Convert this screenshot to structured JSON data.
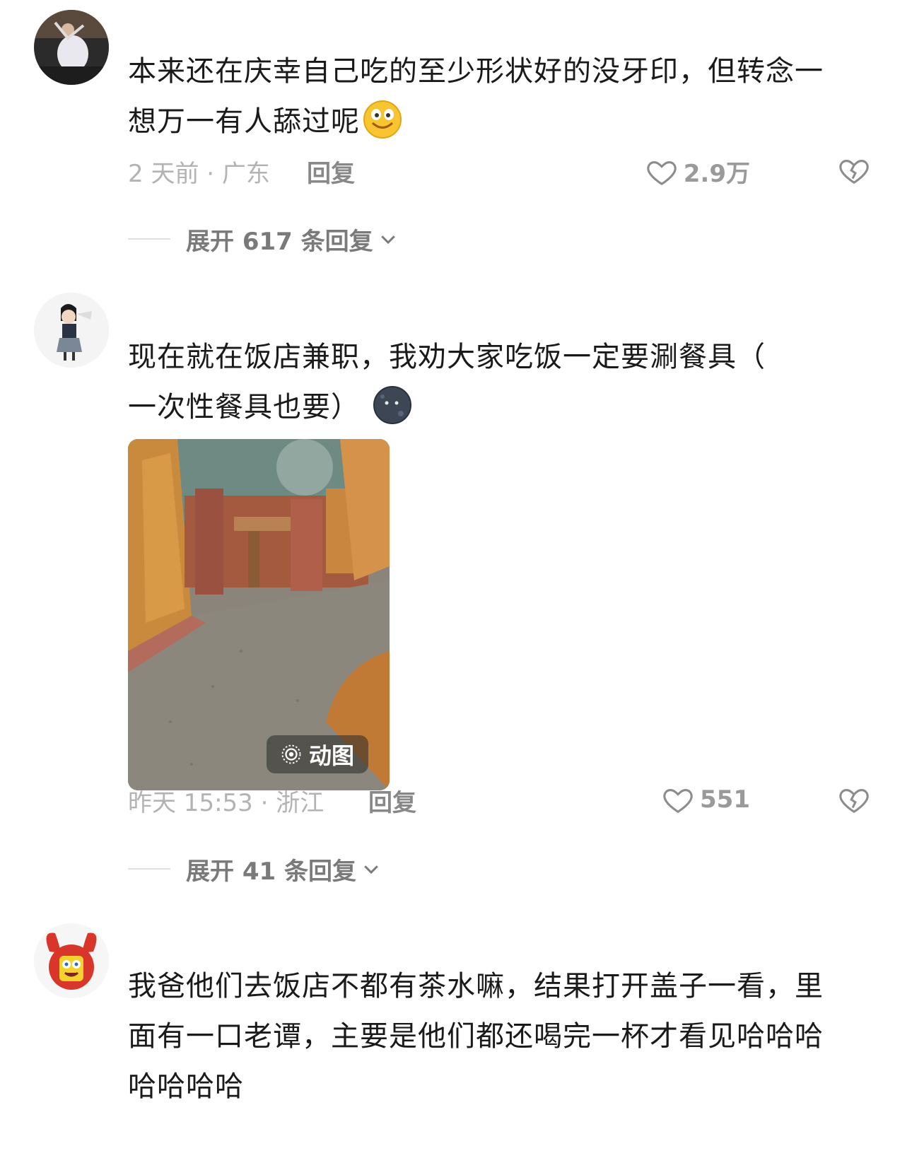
{
  "comments": [
    {
      "text_line1": "本来还在庆幸自己吃的至少形状好的没牙印，但转念一",
      "text_line2": "想万一有人舔过呢",
      "emoji": "grinning-face-emoji",
      "time_location": "2 天前 · 广东",
      "reply_label": "回复",
      "likes": "2.9万",
      "expand_label": "展开 617 条回复"
    },
    {
      "text_line1": "现在就在饭店兼职，我劝大家吃饭一定要涮餐具（",
      "text_line2": "一次性餐具也要）",
      "emoji": "dark-moon-face-emoji",
      "image": "restaurant-interior-photo",
      "image_badge": "动图",
      "time_location": "昨天 15:53 · 浙江",
      "reply_label": "回复",
      "likes": "551",
      "expand_label": "展开 41 条回复"
    },
    {
      "text_line1": "我爸他们去饭店不都有茶水嘛，结果打开盖子一看，里",
      "text_line2": "面有一口老谭，主要是他们都还喝完一杯才看见哈哈哈",
      "text_line3": "哈哈哈哈"
    }
  ],
  "colors": {
    "meta": "#b3b3b3",
    "text": "#1a1a1a",
    "expand": "#7a7a7a"
  }
}
